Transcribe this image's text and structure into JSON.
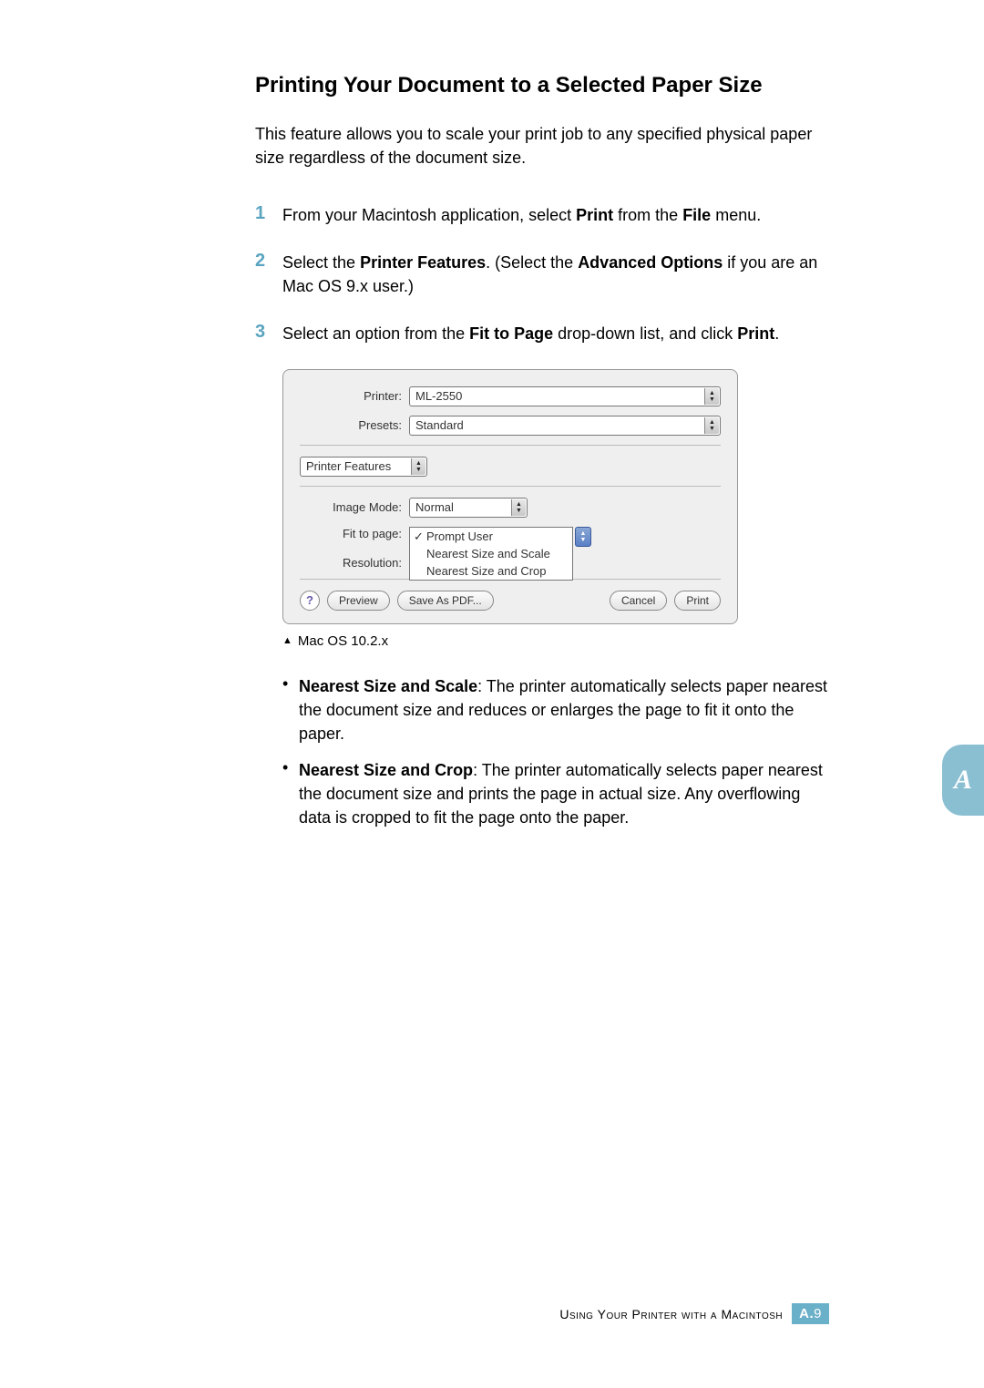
{
  "heading": "Printing Your Document to a Selected Paper Size",
  "intro": "This feature allows you to scale your print job to any specified physical paper size regardless of the document size.",
  "steps": [
    {
      "num": "1",
      "pre": "From your Macintosh application, select ",
      "b1": "Print",
      "mid": " from the ",
      "b2": "File",
      "post": " menu."
    },
    {
      "num": "2",
      "pre": "Select the ",
      "b1": "Printer Features",
      "mid": ". (Select the ",
      "b2": "Advanced Options",
      "post": " if you are an Mac OS 9.x user.)"
    },
    {
      "num": "3",
      "pre": "Select an option from the ",
      "b1": "Fit to Page",
      "mid": " drop-down list, and click ",
      "b2": "Print",
      "post": "."
    }
  ],
  "dialog": {
    "labels": {
      "printer": "Printer:",
      "presets": "Presets:",
      "panel": "Printer Features",
      "image_mode": "Image Mode:",
      "fit_to_page": "Fit to page:",
      "resolution": "Resolution:"
    },
    "values": {
      "printer": "ML-2550",
      "presets": "Standard",
      "image_mode": "Normal"
    },
    "fit_options": [
      "Prompt User",
      "Nearest Size and Scale",
      "Nearest Size and Crop"
    ],
    "buttons": {
      "help": "?",
      "preview": "Preview",
      "save_pdf": "Save As PDF...",
      "cancel": "Cancel",
      "print": "Print"
    }
  },
  "caption": "Mac OS 10.2.x",
  "bullets": [
    {
      "b": "Nearest Size and Scale",
      "text": ": The printer automatically selects paper nearest the document size and reduces or enlarges the page to fit it onto the paper."
    },
    {
      "b": "Nearest Size and Crop",
      "text": ": The printer automatically selects paper nearest the document size and prints the page in actual size. Any overflowing data is cropped to fit the page onto the paper."
    }
  ],
  "side_tab": "A",
  "footer": {
    "text": "Using Your Printer with a Macintosh",
    "badge_letter": "A.",
    "badge_num": "9"
  }
}
